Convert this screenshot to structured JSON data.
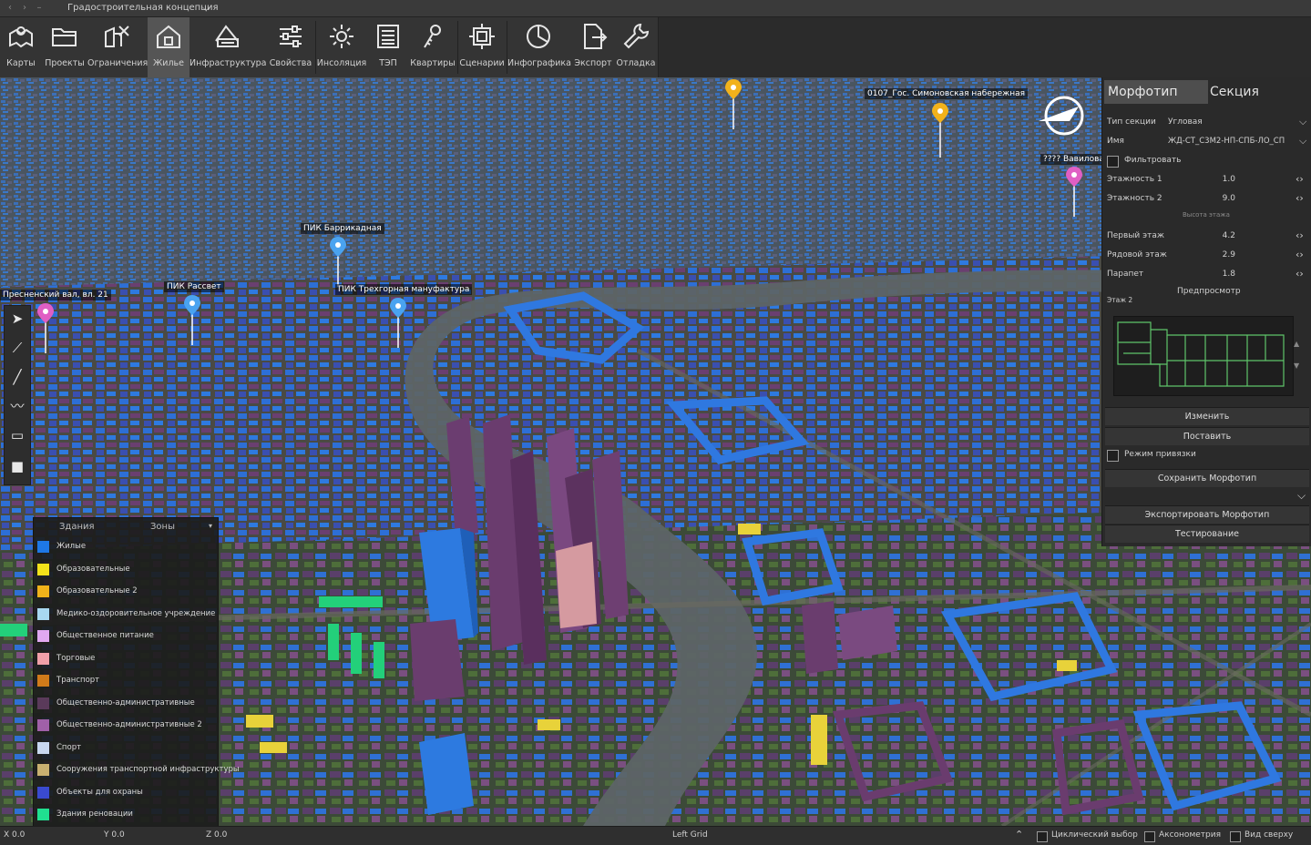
{
  "window": {
    "title": "Градостроительная концепция"
  },
  "toolbar": {
    "items": [
      {
        "label": "Карты",
        "icon": "map-icon"
      },
      {
        "label": "Проекты",
        "icon": "folder-icon"
      },
      {
        "label": "Ограничения",
        "icon": "restrictions-icon"
      },
      {
        "label": "Жилье",
        "icon": "house-icon"
      },
      {
        "label": "Инфраструктура",
        "icon": "infrastructure-icon"
      },
      {
        "label": "Свойства",
        "icon": "sliders-icon"
      },
      {
        "label": "Инсоляция",
        "icon": "sun-icon"
      },
      {
        "label": "ТЭП",
        "icon": "list-icon"
      },
      {
        "label": "Квартиры",
        "icon": "keys-icon"
      },
      {
        "label": "Сценарии",
        "icon": "scenario-icon"
      },
      {
        "label": "Инфографика",
        "icon": "pie-chart-icon"
      },
      {
        "label": "Экспорт",
        "icon": "export-icon"
      },
      {
        "label": "Отладка",
        "icon": "wrench-icon"
      }
    ],
    "active": "Жилье"
  },
  "map": {
    "pins": [
      {
        "label": "0107_Гос. Симоновская набережная",
        "color": "#f2b21b"
      },
      {
        "label": "???? Вавилова",
        "color": "#e05fc4"
      },
      {
        "label": "ПИК Баррикадная",
        "color": "#4aa3f0"
      },
      {
        "label": "ПИК Рассвет",
        "color": "#4aa3f0"
      },
      {
        "label": "ПИК Трехгорная мануфактура",
        "color": "#4aa3f0"
      },
      {
        "label": "Пресненский вал, вл. 21",
        "color": "#e05fc4"
      }
    ]
  },
  "legend": {
    "tab_buildings": "Здания",
    "tab_zones": "Зоны",
    "items": [
      {
        "label": "Жилые",
        "color": "#1e78e6"
      },
      {
        "label": "Образовательные",
        "color": "#f3e21a"
      },
      {
        "label": "Образовательные 2",
        "color": "#f0b21a"
      },
      {
        "label": "Медико-оздоровительное учреждение",
        "color": "#a8d8f0"
      },
      {
        "label": "Общественное питание",
        "color": "#e0a8f0"
      },
      {
        "label": "Торговые",
        "color": "#f0a0a8"
      },
      {
        "label": "Транспорт",
        "color": "#d07a1a"
      },
      {
        "label": "Общественно-административные",
        "color": "#5a3a5a"
      },
      {
        "label": "Общественно-административные 2",
        "color": "#a060a8"
      },
      {
        "label": "Спорт",
        "color": "#c8d8f0"
      },
      {
        "label": "Сооружения транспортной инфраструктуры",
        "color": "#c8b070"
      },
      {
        "label": "Объекты для охраны",
        "color": "#3a4ad0"
      },
      {
        "label": "Здания реновации",
        "color": "#20e090"
      }
    ]
  },
  "panel": {
    "tab_morphotype": "Морфотип",
    "tab_section": "Секция",
    "section_type_label": "Тип секции",
    "section_type_value": "Угловая",
    "name_label": "Имя",
    "name_value": "ЖД-СТ_С3М2-НП-СПБ-ЛО_СП",
    "filter_label": "Фильтровать",
    "floors1_label": "Этажность 1",
    "floors1_value": "1.0",
    "floors2_label": "Этажность 2",
    "floors2_value": "9.0",
    "floor_height_caption": "Высота этажа",
    "first_floor_label": "Первый этаж",
    "first_floor_value": "4.2",
    "typical_floor_label": "Рядовой этаж",
    "typical_floor_value": "2.9",
    "parapet_label": "Парапет",
    "parapet_value": "1.8",
    "preview_label": "Предпросмотр",
    "floor_caption": "Этаж 2",
    "change_button": "Изменить",
    "place_button": "Поставить",
    "snap_label": "Режим привязки",
    "save_button": "Сохранить Морфотип",
    "export_button": "Экспортировать Морфотип",
    "test_button": "Тестирование"
  },
  "status": {
    "x": "X 0.0",
    "y": "Y 0.0",
    "z": "Z 0.0",
    "grid": "Left Grid",
    "cyclic": "Циклический выбор",
    "axonometry": "Аксонометрия",
    "top_view": "Вид сверху"
  }
}
